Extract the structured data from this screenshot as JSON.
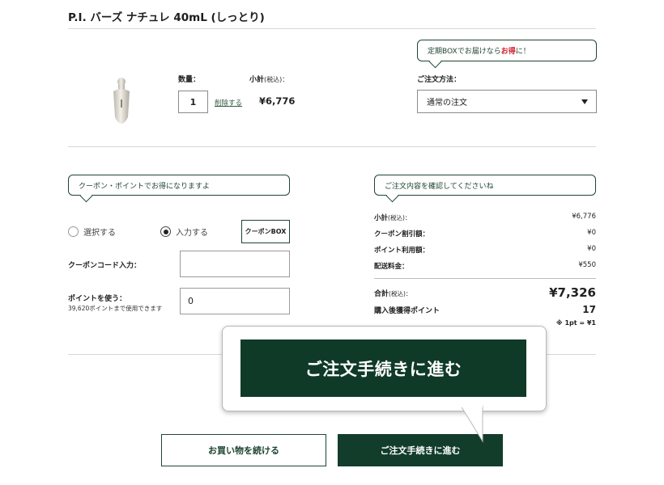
{
  "product": {
    "title": "P.I. バーズ ナチュレ 40mL (しっとり)",
    "quantity_label": "数量：",
    "quantity_value": "1",
    "delete_label": "削除する",
    "subtotal_label": "小計",
    "tax_note": "(税込)：",
    "price": "¥6,776"
  },
  "order_method": {
    "bubble_text_1": "定期BOXでお届けなら",
    "bubble_text_highlight": "お得",
    "bubble_text_2": "に！",
    "label": "ご注文方法：",
    "selected": "通常の注文"
  },
  "coupon": {
    "bubble_text": "クーポン・ポイントでお得になりますよ",
    "option_select": "選択する",
    "option_input": "入力する",
    "coupon_box_label": "クーポンBOX",
    "code_label": "クーポンコード入力：",
    "code_value": "",
    "points_label": "ポイントを使う：",
    "points_note": "39,620ポイントまで使用できます",
    "points_value": "0"
  },
  "summary": {
    "bubble_text": "ご注文内容を確認してくださいね",
    "rows": [
      {
        "label": "小計",
        "suffix": "(税込)：",
        "value": "¥6,776"
      },
      {
        "label": "クーポン割引額：",
        "suffix": "",
        "value": "¥0"
      },
      {
        "label": "ポイント利用額：",
        "suffix": "",
        "value": "¥0"
      },
      {
        "label": "配送料金：",
        "suffix": "",
        "value": "¥550"
      }
    ],
    "total_label": "合計",
    "total_suffix": "(税込)：",
    "total_value": "¥7,326",
    "points_earned_label": "購入後獲得ポイント",
    "points_earned_value": "17",
    "points_rate_note": "※ 1pt = ¥1"
  },
  "actions": {
    "continue_shopping": "お買い物を続ける",
    "checkout": "ご注文手続きに進む",
    "checkout_zoom": "ご注文手続きに進む"
  },
  "colors": {
    "brand_green": "#123d2b",
    "accent_red": "#d0202c"
  }
}
